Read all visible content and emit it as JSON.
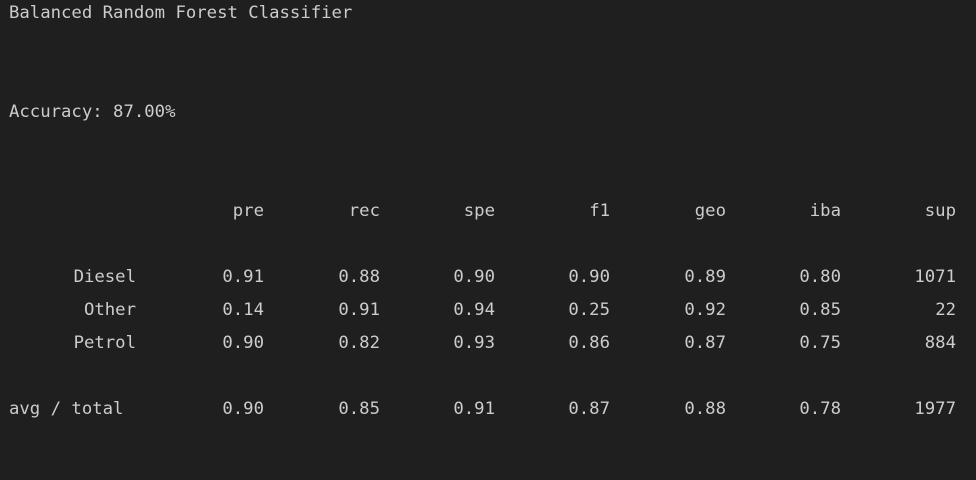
{
  "title": "Balanced Random Forest Classifier",
  "accuracy_text": "Accuracy: 87.00%",
  "report": {
    "headers": [
      "pre",
      "rec",
      "spe",
      "f1",
      "geo",
      "iba",
      "sup"
    ],
    "rows": [
      {
        "label": "Diesel",
        "values": [
          "0.91",
          "0.88",
          "0.90",
          "0.90",
          "0.89",
          "0.80",
          "1071"
        ]
      },
      {
        "label": "Other",
        "values": [
          "0.14",
          "0.91",
          "0.94",
          "0.25",
          "0.92",
          "0.85",
          "22"
        ]
      },
      {
        "label": "Petrol",
        "values": [
          "0.90",
          "0.82",
          "0.93",
          "0.86",
          "0.87",
          "0.75",
          "884"
        ]
      }
    ],
    "total": {
      "label": "avg / total",
      "values": [
        "0.90",
        "0.85",
        "0.91",
        "0.87",
        "0.88",
        "0.78",
        "1977"
      ]
    }
  }
}
